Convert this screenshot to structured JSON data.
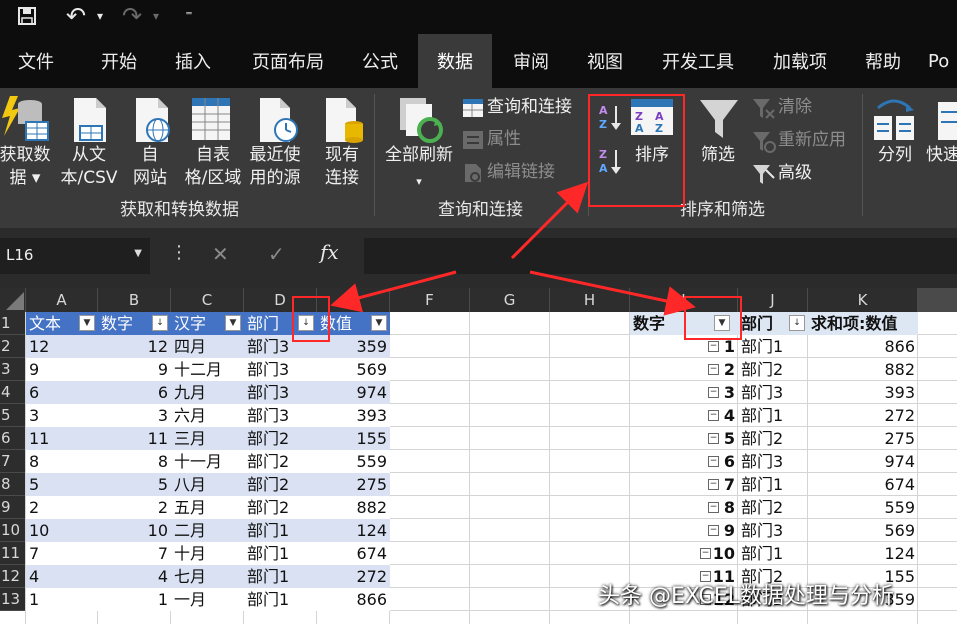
{
  "qat": {
    "undo_glyph": "↶",
    "redo_glyph": "↷",
    "dropdown_glyph": "▾",
    "customize_glyph": "⁼"
  },
  "tabs": [
    "文件",
    "开始",
    "插入",
    "页面布局",
    "公式",
    "数据",
    "审阅",
    "视图",
    "开发工具",
    "加载项",
    "帮助",
    "Po"
  ],
  "active_tab": "数据",
  "ribbon": {
    "get_data": [
      "获取数",
      "据 ▾"
    ],
    "from_text": [
      "从文",
      "本/CSV"
    ],
    "from_web": [
      "自",
      "网站"
    ],
    "from_table": [
      "自表",
      "格/区域"
    ],
    "recent_sources": [
      "最近使",
      "用的源"
    ],
    "existing_conn": [
      "现有",
      "连接"
    ],
    "group1": "获取和转换数据",
    "refresh_all": "全部刷新",
    "refresh_arrow": "▾",
    "queries_conn": "查询和连接",
    "properties": "属性",
    "edit_links": "编辑链接",
    "group2": "查询和连接",
    "sort": "排序",
    "filter": "筛选",
    "clear": "清除",
    "reapply": "重新应用",
    "advanced": "高级",
    "group3": "排序和筛选",
    "text_to_columns": "分列",
    "flash_fill": "快速"
  },
  "formula_bar": {
    "name_box": "L16",
    "cancel": "✕",
    "enter": "✓",
    "fx": "fx",
    "formula": ""
  },
  "columns": [
    "A",
    "B",
    "C",
    "D",
    "E",
    "F",
    "G",
    "H",
    "I",
    "J",
    "K"
  ],
  "rows": [
    "1",
    "2",
    "3",
    "4",
    "5",
    "6",
    "7",
    "8",
    "9",
    "10",
    "11",
    "12",
    "13"
  ],
  "table": {
    "headers": [
      "文本",
      "数字",
      "汉字",
      "部门",
      "数值"
    ],
    "rows": [
      [
        "12",
        "12",
        "四月",
        "部门3",
        "359"
      ],
      [
        "9",
        "9",
        "十二月",
        "部门3",
        "569"
      ],
      [
        "6",
        "6",
        "九月",
        "部门3",
        "974"
      ],
      [
        "3",
        "3",
        "六月",
        "部门3",
        "393"
      ],
      [
        "11",
        "11",
        "三月",
        "部门2",
        "155"
      ],
      [
        "8",
        "8",
        "十一月",
        "部门2",
        "559"
      ],
      [
        "5",
        "5",
        "八月",
        "部门2",
        "275"
      ],
      [
        "2",
        "2",
        "五月",
        "部门2",
        "882"
      ],
      [
        "10",
        "10",
        "二月",
        "部门1",
        "124"
      ],
      [
        "7",
        "7",
        "十月",
        "部门1",
        "674"
      ],
      [
        "4",
        "4",
        "七月",
        "部门1",
        "272"
      ],
      [
        "1",
        "1",
        "一月",
        "部门1",
        "866"
      ]
    ]
  },
  "pivot": {
    "headers": [
      "数字",
      "部门",
      "求和项:数值"
    ],
    "rows": [
      [
        "1",
        "部门1",
        "866"
      ],
      [
        "2",
        "部门2",
        "882"
      ],
      [
        "3",
        "部门3",
        "393"
      ],
      [
        "4",
        "部门1",
        "272"
      ],
      [
        "5",
        "部门2",
        "275"
      ],
      [
        "6",
        "部门3",
        "974"
      ],
      [
        "7",
        "部门1",
        "674"
      ],
      [
        "8",
        "部门2",
        "559"
      ],
      [
        "9",
        "部门3",
        "569"
      ],
      [
        "10",
        "部门1",
        "124"
      ],
      [
        "11",
        "部门2",
        "155"
      ],
      [
        "12",
        "部门3",
        "359"
      ]
    ]
  },
  "watermark": "头条 @EXCEL数据处理与分析"
}
